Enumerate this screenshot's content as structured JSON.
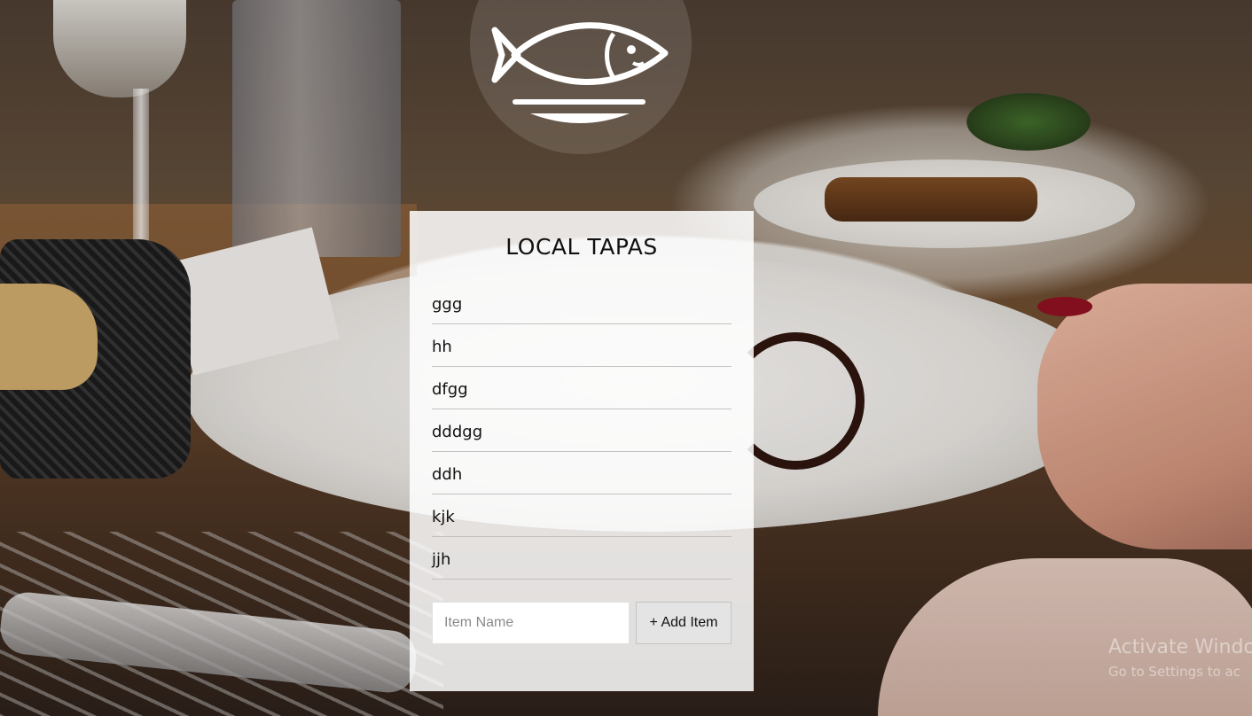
{
  "restaurant": {
    "title": "LOCAL TAPAS",
    "logo_icon": "fish-plate-icon"
  },
  "items": [
    {
      "name": "ggg"
    },
    {
      "name": "hh"
    },
    {
      "name": "dfgg"
    },
    {
      "name": "dddgg"
    },
    {
      "name": "ddh"
    },
    {
      "name": "kjk"
    },
    {
      "name": "jjh"
    }
  ],
  "form": {
    "input_placeholder": "Item Name",
    "input_value": "",
    "add_button_label": "+ Add Item"
  },
  "system": {
    "activate_title": "Activate Windo",
    "activate_sub": "Go to Settings to ac"
  },
  "colors": {
    "card_bg": "#ffffff",
    "button_bg": "#e4e4e4",
    "text": "#111111"
  }
}
